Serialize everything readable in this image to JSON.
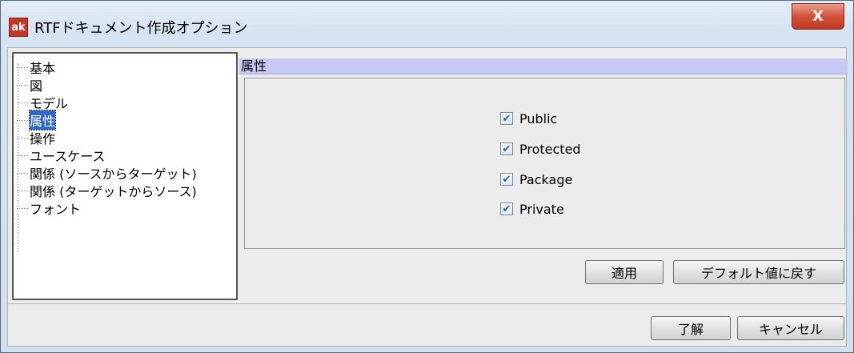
{
  "window": {
    "title": "RTFドキュメント作成オプション",
    "app_icon_text": "ak",
    "close_label": "X"
  },
  "tree": {
    "items": [
      {
        "label": "基本",
        "selected": false
      },
      {
        "label": "図",
        "selected": false
      },
      {
        "label": "モデル",
        "selected": false
      },
      {
        "label": "属性",
        "selected": true
      },
      {
        "label": "操作",
        "selected": false
      },
      {
        "label": "ユースケース",
        "selected": false
      },
      {
        "label": "関係 (ソースからターゲット)",
        "selected": false
      },
      {
        "label": "関係 (ターゲットからソース)",
        "selected": false
      },
      {
        "label": "フォント",
        "selected": false
      }
    ]
  },
  "panel": {
    "header": "属性",
    "checkboxes": [
      {
        "label": "Public",
        "checked": true
      },
      {
        "label": "Protected",
        "checked": true
      },
      {
        "label": "Package",
        "checked": true
      },
      {
        "label": "Private",
        "checked": true
      }
    ],
    "apply_label": "適用",
    "reset_label": "デフォルト値に戻す"
  },
  "footer": {
    "ok_label": "了解",
    "cancel_label": "キャンセル"
  },
  "colors": {
    "selection": "#3168c6",
    "header_bg": "#c8c8f5",
    "close_button": "#c23a22"
  }
}
